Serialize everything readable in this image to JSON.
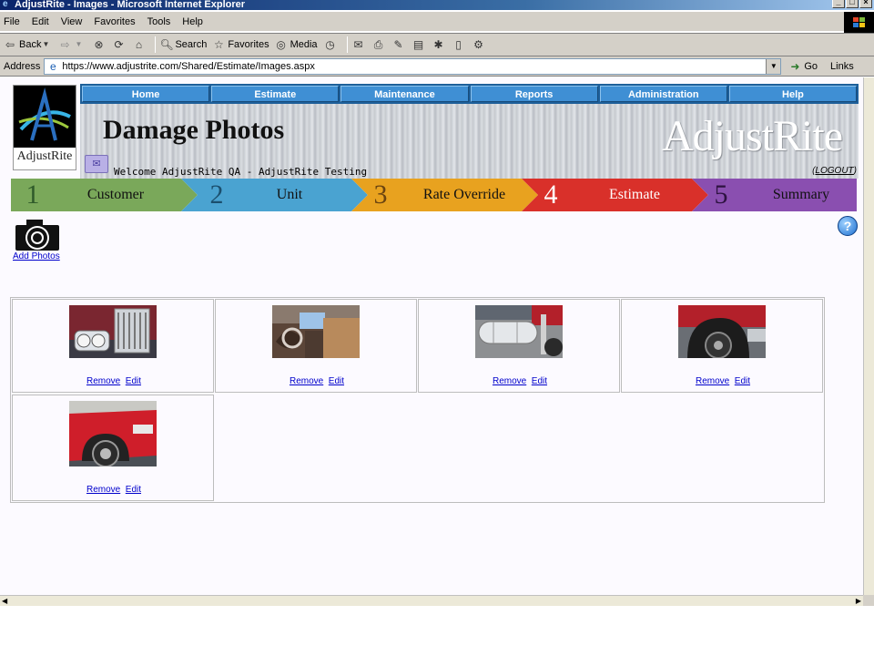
{
  "window": {
    "title": "AdjustRite - Images - Microsoft Internet Explorer"
  },
  "menu": [
    "File",
    "Edit",
    "View",
    "Favorites",
    "Tools",
    "Help"
  ],
  "toolbar": {
    "back": "Back",
    "search": "Search",
    "favorites": "Favorites",
    "media": "Media"
  },
  "address": {
    "label": "Address",
    "url": "https://www.adjustrite.com/Shared/Estimate/Images.aspx",
    "go": "Go",
    "links": "Links"
  },
  "logo": {
    "text": "AdjustRite"
  },
  "nav": [
    "Home",
    "Estimate",
    "Maintenance",
    "Reports",
    "Administration",
    "Help"
  ],
  "banner": {
    "title": "Damage Photos",
    "brand": "AdjustRite",
    "welcome": "Welcome AdjustRite QA - AdjustRite Testing",
    "logout": "LOGOUT"
  },
  "steps": [
    {
      "num": "1",
      "label": "Customer",
      "color": "#7aa85a",
      "numColor": "#2f5a2a"
    },
    {
      "num": "2",
      "label": "Unit",
      "color": "#4aa3d1",
      "numColor": "#1b4f6e"
    },
    {
      "num": "3",
      "label": "Rate Override",
      "color": "#e8a21f",
      "numColor": "#6b4410"
    },
    {
      "num": "4",
      "label": "Estimate",
      "color": "#d9302a",
      "numColor": "#ffffff"
    },
    {
      "num": "5",
      "label": "Summary",
      "color": "#8a4fb0",
      "numColor": "#2d1240"
    }
  ],
  "addPhotos": "Add Photos",
  "photos": [
    {
      "icon": "truck-grille-photo",
      "remove": "Remove",
      "edit": "Edit"
    },
    {
      "icon": "truck-interior-photo",
      "remove": "Remove",
      "edit": "Edit"
    },
    {
      "icon": "truck-tank-photo",
      "remove": "Remove",
      "edit": "Edit"
    },
    {
      "icon": "truck-wheel-photo",
      "remove": "Remove",
      "edit": "Edit"
    },
    {
      "icon": "truck-fender-photo",
      "remove": "Remove",
      "edit": "Edit"
    }
  ]
}
